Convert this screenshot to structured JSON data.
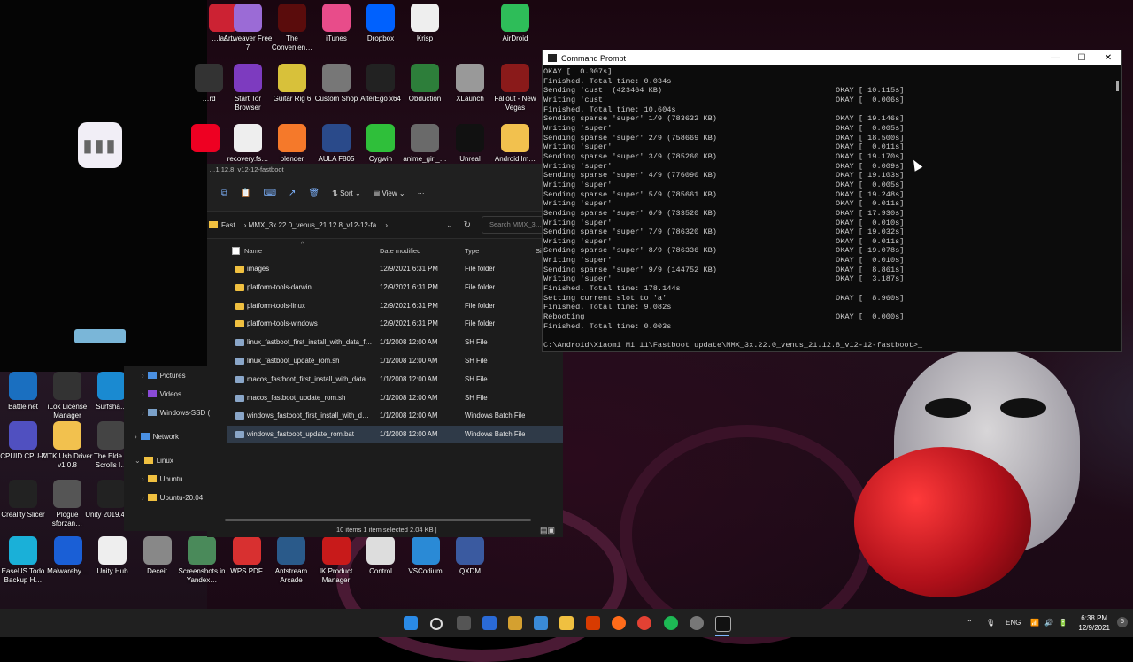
{
  "desktop": {
    "top_icons": [
      {
        "label": "…las…",
        "color": "#c23"
      },
      {
        "label": "Artweaver Free 7",
        "color": "#9b6bd6"
      },
      {
        "label": "The Convenien…",
        "color": "#5a0c0c"
      },
      {
        "label": "iTunes",
        "color": "#e84c8a"
      },
      {
        "label": "Dropbox",
        "color": "#0061fe"
      },
      {
        "label": "Krisp",
        "color": "#eeeeee"
      },
      {
        "label": "AirDroid",
        "color": "#2ebd59"
      }
    ],
    "row2_icons": [
      {
        "label": "…rd",
        "color": "#333"
      },
      {
        "label": "Start Tor Browser",
        "color": "#7d3bbf"
      },
      {
        "label": "Guitar Rig 6",
        "color": "#d8c13a"
      },
      {
        "label": "Custom Shop",
        "color": "#777777"
      },
      {
        "label": "AlterEgo x64",
        "color": "#222222"
      },
      {
        "label": "Obduction",
        "color": "#2d7e3a"
      },
      {
        "label": "XLaunch",
        "color": "#999999"
      },
      {
        "label": "Fallout - New Vegas",
        "color": "#8a1a1a"
      }
    ],
    "row3_icons": [
      {
        "label": "",
        "color": "#e02"
      },
      {
        "label": "recovery.fs…",
        "color": "#eeeeee"
      },
      {
        "label": "blender",
        "color": "#f5792a"
      },
      {
        "label": "AULA F805",
        "color": "#2a4a8a"
      },
      {
        "label": "Cygwin",
        "color": "#2fbf3a"
      },
      {
        "label": "anime_girl_…",
        "color": "#6a6a6a"
      },
      {
        "label": "Unreal",
        "color": "#111111"
      },
      {
        "label": "Android.lm…",
        "color": "#f2c14e"
      }
    ],
    "left_icons": [
      {
        "label": "Battle.net",
        "color": "#1a6fc0"
      },
      {
        "label": "iLok License Manager",
        "color": "#333"
      },
      {
        "label": "Surfsha…",
        "color": "#1a8ad1"
      },
      {
        "label": "CPUID CPU-Z",
        "color": "#5050c0"
      },
      {
        "label": "MTK Usb Driver v1.0.8",
        "color": "#f2c14e"
      },
      {
        "label": "The Elde… Scrolls I…",
        "color": "#444"
      },
      {
        "label": "Creality Slicer",
        "color": "#222"
      },
      {
        "label": "Plogue sforzan…",
        "color": "#555"
      },
      {
        "label": "Unity 2019.4.1…",
        "color": "#222"
      }
    ],
    "bottom_icons": [
      {
        "label": "EaseUS Todo Backup H…",
        "color": "#1ab0d8"
      },
      {
        "label": "Malwareby…",
        "color": "#1a5fd6"
      },
      {
        "label": "Unity Hub",
        "color": "#eeeeee"
      },
      {
        "label": "Deceit",
        "color": "#888888"
      },
      {
        "label": "Screenshots in Yandex…",
        "color": "#4a8a5a"
      },
      {
        "label": "WPS PDF",
        "color": "#d83030"
      },
      {
        "label": "Antstream Arcade",
        "color": "#2a5a8a"
      },
      {
        "label": "IK Product Manager",
        "color": "#c81a1a"
      },
      {
        "label": "Control",
        "color": "#dddddd"
      },
      {
        "label": "VSCodium",
        "color": "#2a8ad6"
      },
      {
        "label": "QXDM",
        "color": "#3a5aa0"
      }
    ]
  },
  "cmd": {
    "title": "Command Prompt",
    "minimize": "—",
    "maximize": "☐",
    "close": "✕",
    "lines": [
      "OKAY [  0.007s]",
      "Finished. Total time: 0.034s",
      "Sending 'cust' (423464 KB)                                      OKAY [ 10.115s]",
      "Writing 'cust'                                                  OKAY [  0.006s]",
      "Finished. Total time: 10.604s",
      "Sending sparse 'super' 1/9 (783632 KB)                          OKAY [ 19.146s]",
      "Writing 'super'                                                 OKAY [  0.005s]",
      "Sending sparse 'super' 2/9 (758669 KB)                          OKAY [ 18.500s]",
      "Writing 'super'                                                 OKAY [  0.011s]",
      "Sending sparse 'super' 3/9 (785260 KB)                          OKAY [ 19.170s]",
      "Writing 'super'                                                 OKAY [  0.009s]",
      "Sending sparse 'super' 4/9 (776090 KB)                          OKAY [ 19.103s]",
      "Writing 'super'                                                 OKAY [  0.005s]",
      "Sending sparse 'super' 5/9 (785661 KB)                          OKAY [ 19.248s]",
      "Writing 'super'                                                 OKAY [  0.011s]",
      "Sending sparse 'super' 6/9 (733520 KB)                          OKAY [ 17.930s]",
      "Writing 'super'                                                 OKAY [  0.010s]",
      "Sending sparse 'super' 7/9 (786320 KB)                          OKAY [ 19.032s]",
      "Writing 'super'                                                 OKAY [  0.011s]",
      "Sending sparse 'super' 8/9 (786336 KB)                          OKAY [ 19.078s]",
      "Writing 'super'                                                 OKAY [  0.010s]",
      "Sending sparse 'super' 9/9 (144752 KB)                          OKAY [  8.861s]",
      "Writing 'super'                                                 OKAY [  3.187s]",
      "Finished. Total time: 178.144s",
      "Setting current slot to 'a'                                     OKAY [  8.960s]",
      "Finished. Total time: 9.082s",
      "Rebooting                                                       OKAY [  0.000s]",
      "Finished. Total time: 0.003s",
      "",
      "C:\\Android\\Xiaomi Mi 11\\Fastboot update\\MMX_3x.22.0_venus_21.12.8_v12-12-fastboot>_"
    ]
  },
  "explorer": {
    "title": "…1.12.8_v12-12-fastboot",
    "toolbar": {
      "sort": "Sort",
      "view": "View",
      "more": "···"
    },
    "breadcrumb": "Fast…  ›  MMX_3x.22.0_venus_21.12.8_v12-12-fa…  ›",
    "search_placeholder": "Search MMX_3…",
    "columns": {
      "name": "Name",
      "date": "Date modified",
      "type": "Type",
      "size": "Si"
    },
    "files": [
      {
        "name": "images",
        "date": "12/9/2021 6:31 PM",
        "type": "File folder",
        "kind": "folder"
      },
      {
        "name": "platform-tools-darwin",
        "date": "12/9/2021 6:31 PM",
        "type": "File folder",
        "kind": "folder"
      },
      {
        "name": "platform-tools-linux",
        "date": "12/9/2021 6:31 PM",
        "type": "File folder",
        "kind": "folder"
      },
      {
        "name": "platform-tools-windows",
        "date": "12/9/2021 6:31 PM",
        "type": "File folder",
        "kind": "folder"
      },
      {
        "name": "linux_fastboot_first_install_with_data_f…",
        "date": "1/1/2008 12:00 AM",
        "type": "SH File",
        "kind": "file"
      },
      {
        "name": "linux_fastboot_update_rom.sh",
        "date": "1/1/2008 12:00 AM",
        "type": "SH File",
        "kind": "file"
      },
      {
        "name": "macos_fastboot_first_install_with_data…",
        "date": "1/1/2008 12:00 AM",
        "type": "SH File",
        "kind": "file"
      },
      {
        "name": "macos_fastboot_update_rom.sh",
        "date": "1/1/2008 12:00 AM",
        "type": "SH File",
        "kind": "file"
      },
      {
        "name": "windows_fastboot_first_install_with_d…",
        "date": "1/1/2008 12:00 AM",
        "type": "Windows Batch File",
        "kind": "file"
      },
      {
        "name": "windows_fastboot_update_rom.bat",
        "date": "1/1/2008 12:00 AM",
        "type": "Windows Batch File",
        "kind": "file",
        "selected": true
      }
    ],
    "status": "10 items   1 item selected  2.04 KB  |"
  },
  "navtree": [
    {
      "label": "Pictures",
      "color": "#4a90e2",
      "indent": 1,
      "chev": "›"
    },
    {
      "label": "Videos",
      "color": "#8a4ad6",
      "indent": 1,
      "chev": "›"
    },
    {
      "label": "Windows-SSD (",
      "color": "#7aa0c8",
      "indent": 1,
      "chev": "›"
    },
    {
      "label": "Network",
      "color": "#4a90e2",
      "indent": 0,
      "chev": "›"
    },
    {
      "label": "Linux",
      "color": "#f0c040",
      "indent": 0,
      "chev": "⌄"
    },
    {
      "label": "Ubuntu",
      "color": "#f0c040",
      "indent": 1,
      "chev": "›"
    },
    {
      "label": "Ubuntu-20.04",
      "color": "#f0c040",
      "indent": 1,
      "chev": "›"
    }
  ],
  "taskbar": {
    "lang": "ENG",
    "time": "6:38 PM",
    "date": "12/9/2021",
    "notif_count": "5"
  }
}
